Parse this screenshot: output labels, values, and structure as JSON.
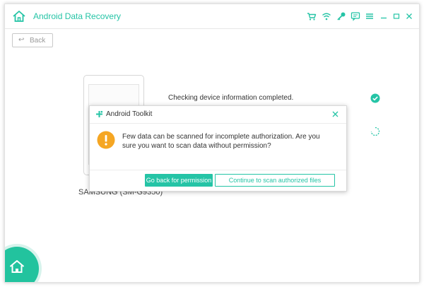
{
  "app": {
    "title": "Android Data Recovery",
    "accent_color": "#25c4a6",
    "titlebar_icons": [
      "cart-icon",
      "wifi-icon",
      "key-icon",
      "feedback-icon",
      "menu-icon",
      "minimize-icon",
      "maximize-icon",
      "close-icon"
    ]
  },
  "toolbar": {
    "back_label": "Back"
  },
  "status": {
    "checking_text": "Checking device information completed.",
    "device_label": "SAMSUNG (SM-G9350)"
  },
  "dialog": {
    "title": "Android Toolkit",
    "message": "Few data can be scanned for incomplete authorization. Are you sure you want to scan data without permission?",
    "primary_button": "Go back for permission",
    "secondary_button": "Continue to scan authorized files",
    "warning_color": "#f5a623"
  }
}
